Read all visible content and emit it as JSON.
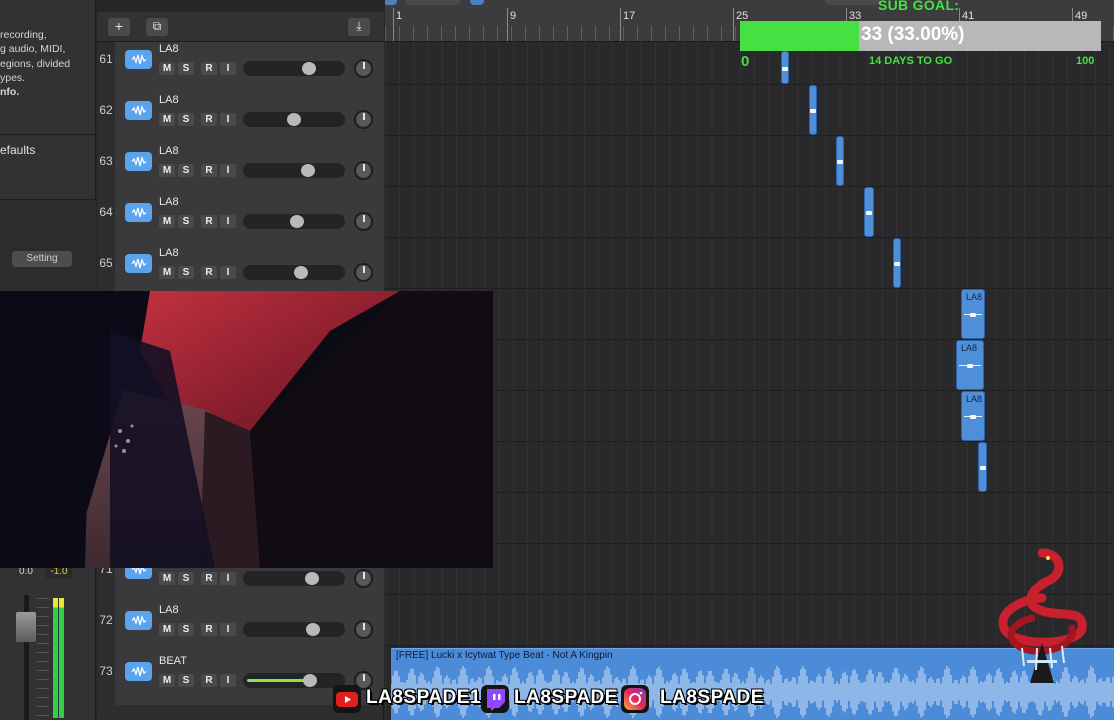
{
  "inspector": {
    "help_lines": [
      "recording,",
      "g audio, MIDI,",
      "egions, divided",
      "ypes."
    ],
    "help_bold": "nfo.",
    "defaults_label": "efaults",
    "setting_button": "Setting",
    "volume_db": "0.0",
    "peak_db": "-1.0"
  },
  "toolbar": {
    "add_symbol": "+",
    "duplicate_symbol": "⧉",
    "download_symbol": "⤓"
  },
  "ruler": {
    "bars": [
      "1",
      "9",
      "17",
      "25",
      "33",
      "41",
      "49"
    ]
  },
  "track_controls": {
    "mute": "M",
    "solo": "S",
    "record": "R",
    "input": "I"
  },
  "tracks": [
    {
      "number": "61",
      "name": "LA8",
      "volume": 0.66
    },
    {
      "number": "62",
      "name": "LA8",
      "volume": 0.5
    },
    {
      "number": "63",
      "name": "LA8",
      "volume": 0.65
    },
    {
      "number": "64",
      "name": "LA8",
      "volume": 0.53
    },
    {
      "number": "65",
      "name": "LA8",
      "volume": 0.57
    },
    {
      "number": "71",
      "name": "",
      "volume": 0.69
    },
    {
      "number": "72",
      "name": "LA8",
      "volume": 0.7
    },
    {
      "number": "73",
      "name": "BEAT",
      "volume": 0.67
    }
  ],
  "regions": [
    {
      "name": "",
      "lane": 0
    },
    {
      "name": "",
      "lane": 1
    },
    {
      "name": "",
      "lane": 2
    },
    {
      "name": "",
      "lane": 3
    },
    {
      "name": "",
      "lane": 4
    },
    {
      "name": "LA8",
      "lane": 5
    },
    {
      "name": "LA8",
      "lane": 6
    },
    {
      "name": "LA8",
      "lane": 7
    },
    {
      "name": "",
      "lane": 8
    }
  ],
  "beat_region": {
    "title": "[FREE] Lucki x Icytwat Type Beat - Not A Kingpin"
  },
  "overlay": {
    "sub_goal_label": "SUB GOAL:",
    "goal_text": "33 (33.00%)",
    "goal_progress": 0.33,
    "goal_min": "0",
    "goal_max": "100",
    "days_left": "14 DAYS TO GO"
  },
  "socials": {
    "youtube": "LA8SPADE1",
    "twitch": "LA8SPADE",
    "instagram": "LA8SPADE"
  },
  "colors": {
    "track_icon": "#5aa4ee",
    "region": "#4f8fd8",
    "goal_green": "#46e043",
    "meter_green": "#2fd04a"
  }
}
